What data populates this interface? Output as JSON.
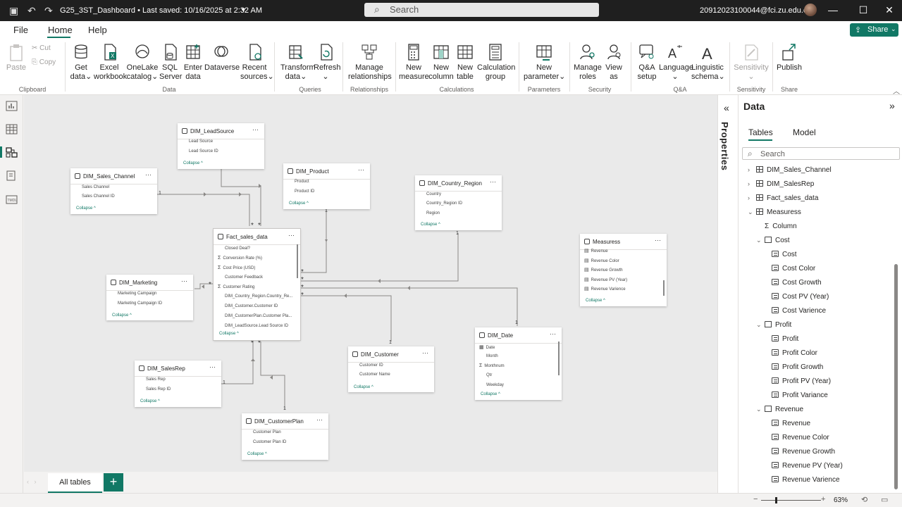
{
  "titlebar": {
    "doc_title": "G25_3ST_Dashboard • Last saved: 10/16/2025 at 2:32 AM",
    "search_placeholder": "Search",
    "user_email": "20912023100044@fci.zu.edu.eg"
  },
  "menu": {
    "file": "File",
    "home": "Home",
    "help": "Help",
    "share": "Share"
  },
  "ribbon": {
    "paste": "Paste",
    "cut": "Cut",
    "copy": "Copy",
    "get_data": [
      "Get",
      "data"
    ],
    "excel": [
      "Excel",
      "workbook"
    ],
    "onelake": [
      "OneLake",
      "catalog"
    ],
    "sql": [
      "SQL",
      "Server"
    ],
    "enter_data": [
      "Enter",
      "data"
    ],
    "dataverse": [
      "Dataverse",
      ""
    ],
    "recent": [
      "Recent",
      "sources"
    ],
    "transform": [
      "Transform",
      "data"
    ],
    "refresh": [
      "Refresh",
      ""
    ],
    "manage_rel": [
      "Manage",
      "relationships"
    ],
    "new_measure": [
      "New",
      "measure"
    ],
    "new_column": [
      "New",
      "column"
    ],
    "new_table": [
      "New",
      "table"
    ],
    "calc_group": [
      "Calculation",
      "group"
    ],
    "new_param": [
      "New",
      "parameter"
    ],
    "manage_roles": [
      "Manage",
      "roles"
    ],
    "view_as": [
      "View",
      "as"
    ],
    "qa_setup": [
      "Q&A",
      "setup"
    ],
    "language": [
      "Language",
      ""
    ],
    "ling": [
      "Linguistic",
      "schema"
    ],
    "sensitivity": [
      "Sensitivity",
      ""
    ],
    "publish": [
      "Publish",
      ""
    ],
    "groups": {
      "clipboard": "Clipboard",
      "data": "Data",
      "queries": "Queries",
      "relationships": "Relationships",
      "calculations": "Calculations",
      "parameters": "Parameters",
      "security": "Security",
      "qa": "Q&A",
      "sensitivity": "Sensitivity",
      "share": "Share"
    }
  },
  "canvas": {
    "tables": {
      "lead": {
        "name": "DIM_LeadSource",
        "fields": [
          "Lead Source",
          "Lead Source ID"
        ],
        "collapse": "Collapse"
      },
      "product": {
        "name": "DIM_Product",
        "fields": [
          "Product",
          "Product ID"
        ],
        "collapse": "Collapse"
      },
      "country": {
        "name": "DIM_Country_Region",
        "fields": [
          "Country",
          "Country_Region ID",
          "Region"
        ],
        "collapse": "Collapse"
      },
      "channel": {
        "name": "DIM_Sales_Channel",
        "fields": [
          "Sales Channel",
          "Sales Channel ID"
        ],
        "collapse": "Collapse"
      },
      "fact": {
        "name": "Fact_sales_data",
        "fields": [
          "Closed Deal?",
          "Conversion Rate (%)",
          "Cost Price (USD)",
          "Customer Feedback",
          "Customer Rating",
          "DIM_Country_Region.Country_Re...",
          "DIM_Customer.Customer ID",
          "DIM_CustomerPlan.Customer Pla...",
          "DIM_LeadSource.Lead Source ID"
        ],
        "collapse": "Collapse"
      },
      "marketing": {
        "name": "DIM_Marketing",
        "fields": [
          "Marketing Campaign",
          "Marketing Campaign ID"
        ],
        "collapse": "Collapse"
      },
      "measures": {
        "name": "Measuress",
        "fields": [
          "Revenue",
          "Revenue Color",
          "Revenue Growth",
          "Revenue PV (Year)",
          "Revenue Varience"
        ],
        "collapse": "Collapse"
      },
      "customer": {
        "name": "DIM_Customer",
        "fields": [
          "Customer ID",
          "Customer Name"
        ],
        "collapse": "Collapse"
      },
      "date": {
        "name": "DIM_Date",
        "fields": [
          "Date",
          "Month",
          "Monthnum",
          "Qtr",
          "Weekday"
        ],
        "collapse": "Collapse"
      },
      "salesrep": {
        "name": "DIM_SalesRep",
        "fields": [
          "Sales Rep",
          "Sales Rep ID"
        ],
        "collapse": "Collapse"
      },
      "custplan": {
        "name": "DIM_CustomerPlan",
        "fields": [
          "Customer Plan",
          "Customer Plan ID"
        ],
        "collapse": "Collapse"
      }
    },
    "page_tab": "All tables",
    "add_tab": "+",
    "cardinality": {
      "one": "1",
      "many": "*"
    }
  },
  "properties": {
    "label": "Properties"
  },
  "datapane": {
    "title": "Data",
    "tab_tables": "Tables",
    "tab_model": "Model",
    "search_placeholder": "Search",
    "tree": [
      {
        "label": "DIM_Sales_Channel",
        "type": "table",
        "arrow": "›"
      },
      {
        "label": "DIM_SalesRep",
        "type": "table",
        "arrow": "›"
      },
      {
        "label": "Fact_sales_data",
        "type": "table",
        "arrow": "›"
      },
      {
        "label": "Measuress",
        "type": "table",
        "arrow": "⌄"
      },
      {
        "label": "Column",
        "type": "sigma"
      },
      {
        "label": "Cost",
        "type": "folder",
        "arrow": "⌄"
      },
      {
        "label": "Cost",
        "type": "calc"
      },
      {
        "label": "Cost Color",
        "type": "calc"
      },
      {
        "label": "Cost Growth",
        "type": "calc"
      },
      {
        "label": "Cost PV (Year)",
        "type": "calc"
      },
      {
        "label": "Cost Varience",
        "type": "calc"
      },
      {
        "label": "Profit",
        "type": "folder",
        "arrow": "⌄"
      },
      {
        "label": "Profit",
        "type": "calc"
      },
      {
        "label": "Profit Color",
        "type": "calc"
      },
      {
        "label": "Profit Growth",
        "type": "calc"
      },
      {
        "label": "Profit PV (Year)",
        "type": "calc"
      },
      {
        "label": "Profit Variance",
        "type": "calc"
      },
      {
        "label": "Revenue",
        "type": "folder",
        "arrow": "⌄"
      },
      {
        "label": "Revenue",
        "type": "calc"
      },
      {
        "label": "Revenue Color",
        "type": "calc"
      },
      {
        "label": "Revenue Growth",
        "type": "calc"
      },
      {
        "label": "Revenue PV (Year)",
        "type": "calc"
      },
      {
        "label": "Revenue Varience",
        "type": "calc"
      }
    ]
  },
  "status": {
    "zoom": "63%",
    "minus": "−",
    "plus": "+"
  },
  "colors": {
    "accent": "#117865",
    "titlebar": "#1f1f1f"
  }
}
